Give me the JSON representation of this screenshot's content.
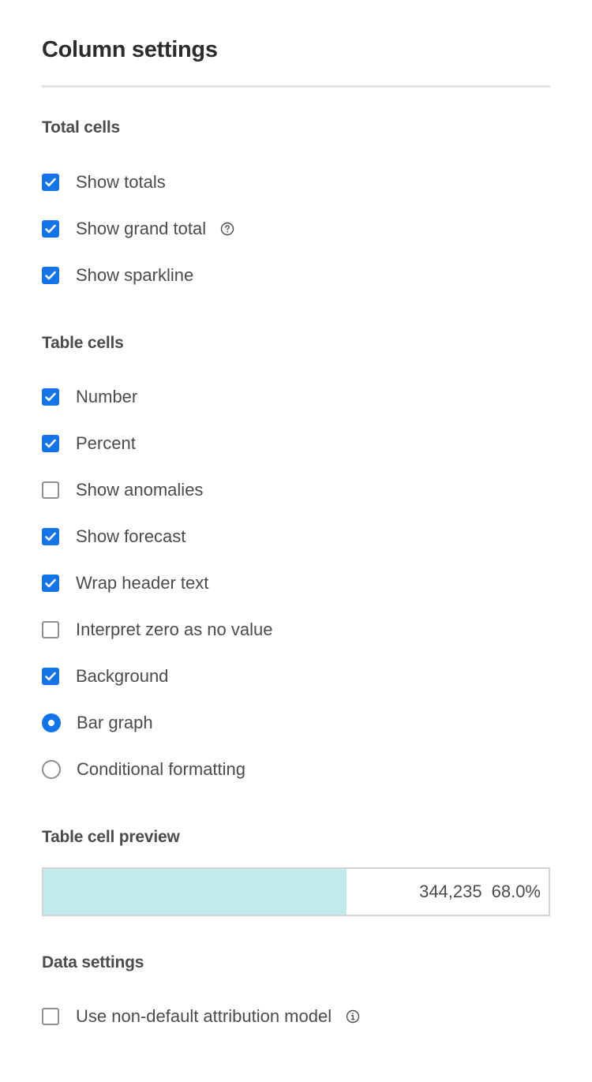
{
  "panel": {
    "title": "Column settings"
  },
  "sections": {
    "total_cells": {
      "heading": "Total cells",
      "options": [
        {
          "label": "Show totals",
          "type": "checkbox",
          "checked": true
        },
        {
          "label": "Show grand total",
          "type": "checkbox",
          "checked": true,
          "help_icon": "help-circle-icon"
        },
        {
          "label": "Show sparkline",
          "type": "checkbox",
          "checked": true
        }
      ]
    },
    "table_cells": {
      "heading": "Table cells",
      "options": [
        {
          "label": "Number",
          "type": "checkbox",
          "checked": true
        },
        {
          "label": "Percent",
          "type": "checkbox",
          "checked": true
        },
        {
          "label": "Show anomalies",
          "type": "checkbox",
          "checked": false
        },
        {
          "label": "Show forecast",
          "type": "checkbox",
          "checked": true
        },
        {
          "label": "Wrap header text",
          "type": "checkbox",
          "checked": true
        },
        {
          "label": "Interpret zero as no value",
          "type": "checkbox",
          "checked": false
        },
        {
          "label": "Background",
          "type": "checkbox",
          "checked": true
        },
        {
          "label": "Bar graph",
          "type": "radio",
          "checked": true
        },
        {
          "label": "Conditional formatting",
          "type": "radio",
          "checked": false
        }
      ]
    },
    "preview": {
      "heading": "Table cell preview",
      "number": "344,235",
      "percent": "68.0%",
      "bar_fill_fraction": 0.6,
      "bar_color": "#c2eaed"
    },
    "data_settings": {
      "heading": "Data settings",
      "options": [
        {
          "label": "Use non-default attribution model",
          "type": "checkbox",
          "checked": false,
          "help_icon": "info-circle-icon"
        }
      ]
    }
  },
  "colors": {
    "accent": "#1473e6",
    "text": "#4b4b4b",
    "title": "#2c2c2c",
    "divider": "#e1e1e1"
  }
}
